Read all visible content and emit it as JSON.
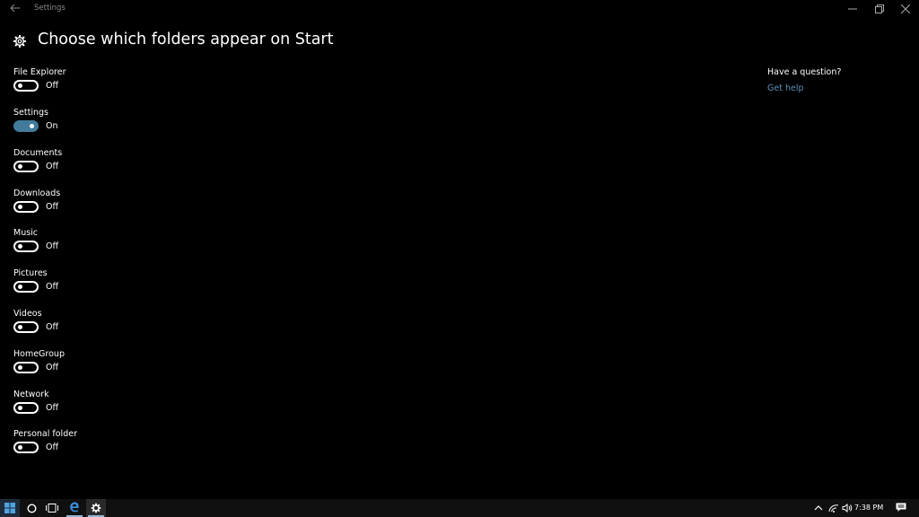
{
  "window": {
    "title": "Settings"
  },
  "page": {
    "title": "Choose which folders appear on Start"
  },
  "folders": [
    {
      "label": "File Explorer",
      "state": "Off",
      "on": false
    },
    {
      "label": "Settings",
      "state": "On",
      "on": true
    },
    {
      "label": "Documents",
      "state": "Off",
      "on": false
    },
    {
      "label": "Downloads",
      "state": "Off",
      "on": false
    },
    {
      "label": "Music",
      "state": "Off",
      "on": false
    },
    {
      "label": "Pictures",
      "state": "Off",
      "on": false
    },
    {
      "label": "Videos",
      "state": "Off",
      "on": false
    },
    {
      "label": "HomeGroup",
      "state": "Off",
      "on": false
    },
    {
      "label": "Network",
      "state": "Off",
      "on": false
    },
    {
      "label": "Personal folder",
      "state": "Off",
      "on": false
    }
  ],
  "help": {
    "question": "Have a question?",
    "link": "Get help"
  },
  "taskbar": {
    "clock": "7:38 PM",
    "icons": [
      "windows-start-icon",
      "cortana-circle-icon",
      "task-view-icon",
      "edge-icon",
      "settings-gear-icon",
      "chevron-up-icon",
      "network-icon",
      "volume-icon",
      "action-center-icon"
    ]
  },
  "colors": {
    "toggle_on": "#427b9b",
    "link": "#5d90b8",
    "background": "#000000"
  }
}
